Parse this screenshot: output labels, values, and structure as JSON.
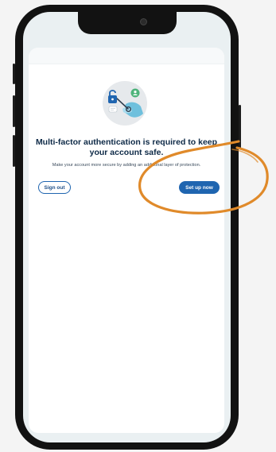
{
  "app": {
    "title": "Multi-factor authentication is required to keep your account safe.",
    "subtitle": "Make your account more secure by adding an additional layer of protection."
  },
  "actions": {
    "sign_out_label": "Sign out",
    "setup_label": "Set up now"
  },
  "colors": {
    "primary": "#1f65b0",
    "title_text": "#0e2a47",
    "annotation": "#e08a2a"
  },
  "icons": {
    "illustration": "lock-key-hand-illustration"
  }
}
